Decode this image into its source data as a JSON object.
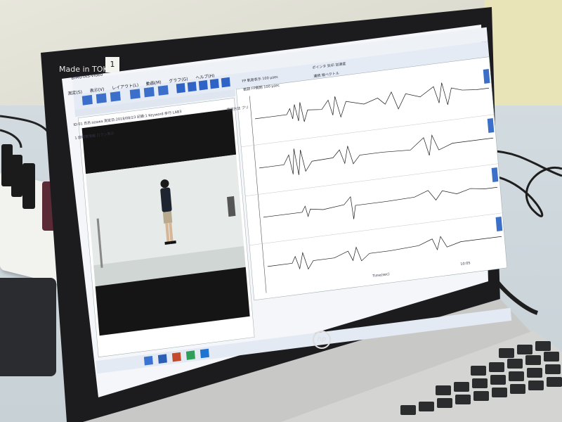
{
  "laptop": {
    "brand_label": "Made in TOKYO",
    "sticker": "1",
    "logo": "hp"
  },
  "app": {
    "title": "BIMUTAS-Video",
    "menus": [
      "測定(S)",
      "表示(V)",
      "レイアウト(L)",
      "動画(M)",
      "グラフ(G)",
      "ヘルプ(H)"
    ],
    "toolbar_checks": [
      "FP",
      "軌跡表示",
      "軌跡",
      "FP開閉"
    ],
    "toolbar_fields": [
      "100 μsec",
      "100 μsec"
    ],
    "right_checks": [
      "ポインタ",
      "矢印",
      "加速度",
      "連続",
      "縦ベクトル"
    ],
    "info_line": "ID:01 氏名:ozawa 測定日:2018/08/23 記録:1 Keyword:歩行 LAB3",
    "video_panel": {
      "tab": "1",
      "check_label": "詳細書情報",
      "extra_label": "ロラン表示"
    },
    "graph_panel": {
      "selector_label": "選択方法",
      "selector_value": "ブリ",
      "time_axis_label": "Time(sec)"
    },
    "taskbar_time": "10:05"
  },
  "colors": {
    "screen_bg": "#f4f6fa",
    "window_chrome": "#dfe6f0",
    "toolbar_blue": "#3b6fc9",
    "waveform": "#1d1d1d",
    "video_wall": "#e6eae8",
    "video_floor": "#7f8a8a",
    "taskbar": "#e3eaf3"
  }
}
